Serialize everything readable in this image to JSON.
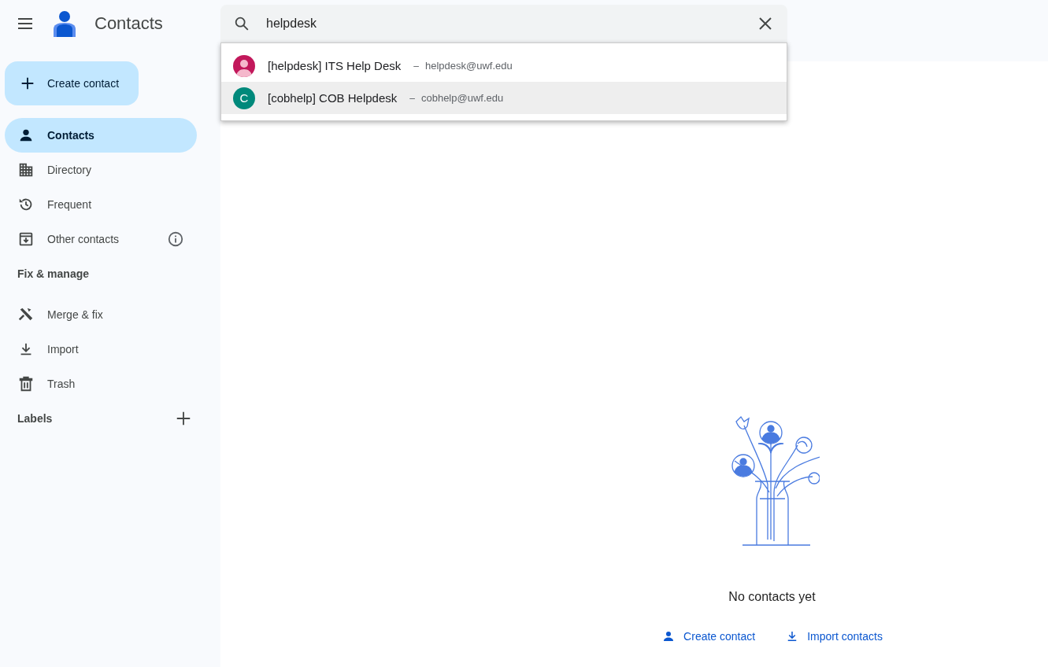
{
  "app": {
    "title": "Contacts"
  },
  "search": {
    "value": "helpdesk"
  },
  "results": [
    {
      "kind": "photo",
      "label": "[helpdesk] ITS Help Desk",
      "separator": "–",
      "email": "helpdesk@uwf.edu",
      "color": "#c2185b",
      "selected": false
    },
    {
      "kind": "letter",
      "letter": "C",
      "label": "[cobhelp] COB Helpdesk",
      "separator": "–",
      "email": "cobhelp@uwf.edu",
      "color": "#00897b",
      "selected": true
    }
  ],
  "create_button": "Create contact",
  "nav": [
    {
      "label": "Contacts",
      "selected": true,
      "info": false
    },
    {
      "label": "Directory",
      "selected": false,
      "info": false
    },
    {
      "label": "Frequent",
      "selected": false,
      "info": false
    },
    {
      "label": "Other contacts",
      "selected": false,
      "info": true
    }
  ],
  "fix_heading": "Fix & manage",
  "fix_items": [
    {
      "label": "Merge & fix",
      "selected": false
    },
    {
      "label": "Import",
      "selected": false
    },
    {
      "label": "Trash",
      "selected": false
    }
  ],
  "labels_heading": "Labels",
  "empty": {
    "message": "No contacts yet",
    "actions": [
      {
        "label": "Create contact"
      },
      {
        "label": "Import contacts"
      }
    ]
  }
}
